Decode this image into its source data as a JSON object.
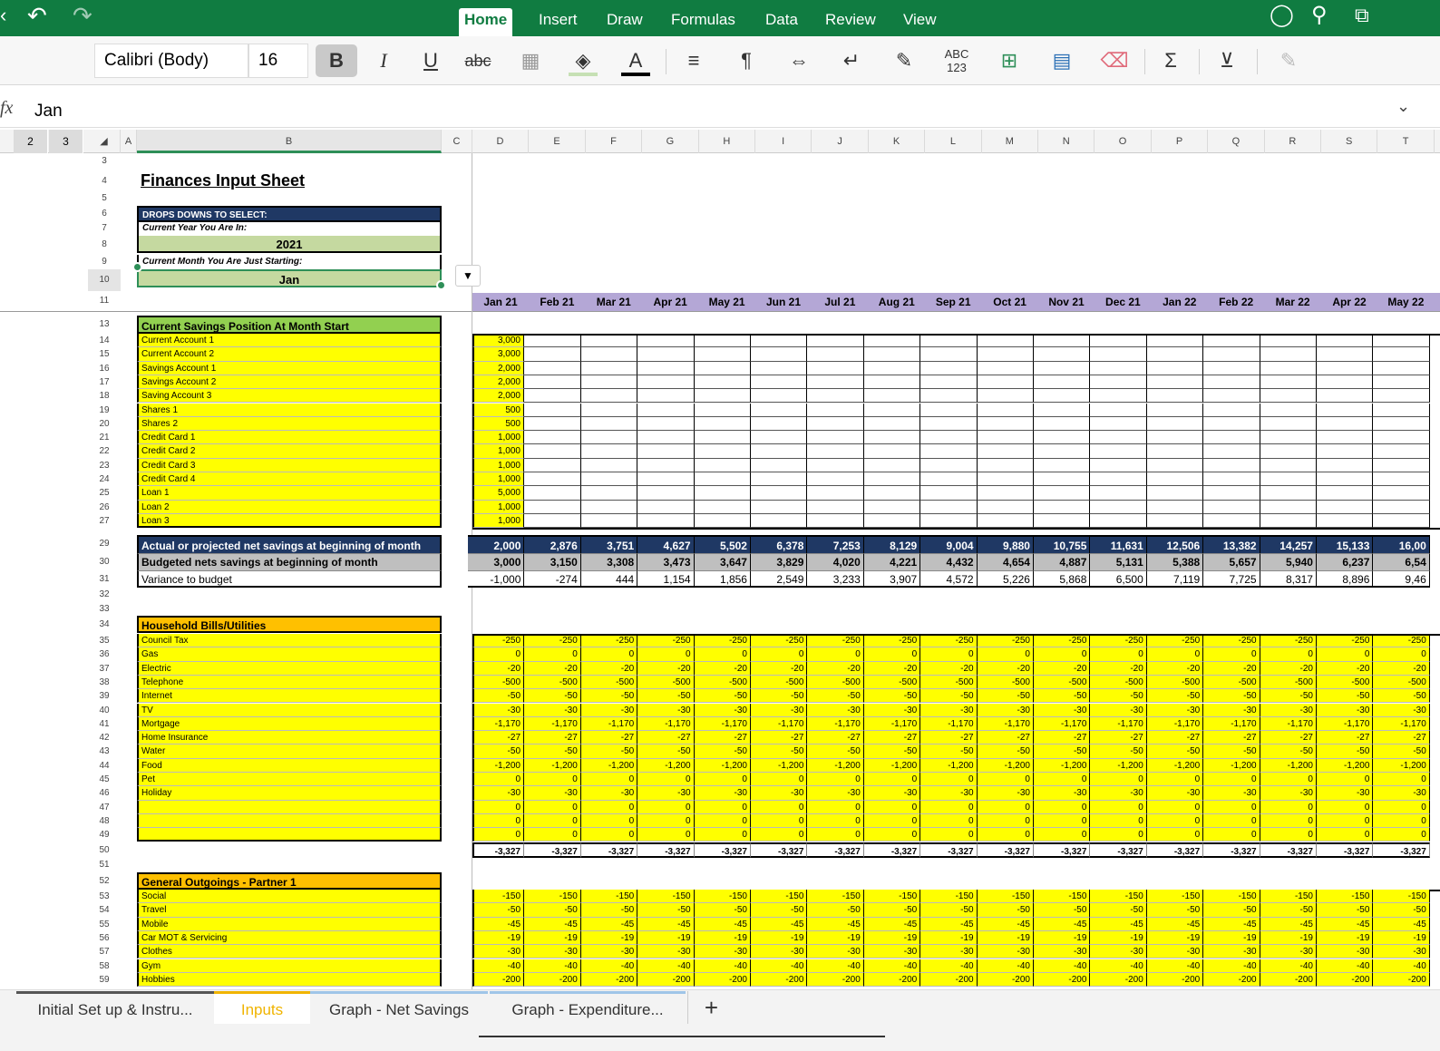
{
  "ribbon": {
    "tabs": [
      "Home",
      "Insert",
      "Draw",
      "Formulas",
      "Data",
      "Review",
      "View"
    ],
    "active": "Home"
  },
  "toolbar": {
    "font_name": "Calibri (Body)",
    "font_size": "16",
    "abc_label": "ABC",
    "num_label": "123"
  },
  "formula_bar": {
    "fx": "fx",
    "value": "Jan"
  },
  "outline_levels": [
    "2",
    "3"
  ],
  "columns": [
    "A",
    "B",
    "C",
    "D",
    "E",
    "F",
    "G",
    "H",
    "I",
    "J",
    "K",
    "L",
    "M",
    "N",
    "O",
    "P",
    "Q",
    "R",
    "S",
    "T"
  ],
  "sheet": {
    "title": "Finances Input Sheet",
    "dropdowns_header": "DROPS DOWNS TO SELECT:",
    "year_label": "Current Year You Are In:",
    "year_value": "2021",
    "month_label": "Current Month You Are Just Starting:",
    "month_value": "Jan",
    "months": [
      "Jan 21",
      "Feb 21",
      "Mar 21",
      "Apr 21",
      "May 21",
      "Jun 21",
      "Jul 21",
      "Aug 21",
      "Sep 21",
      "Oct 21",
      "Nov 21",
      "Dec 21",
      "Jan 22",
      "Feb 22",
      "Mar 22",
      "Apr 22",
      "May 22"
    ],
    "savings_header": "Current Savings Position At Month Start",
    "savings_items": [
      [
        "Current Account 1",
        "3,000"
      ],
      [
        "Current Account 2",
        "3,000"
      ],
      [
        "Savings Account 1",
        "2,000"
      ],
      [
        "Savings Account 2",
        "2,000"
      ],
      [
        "Saving Account 3",
        "2,000"
      ],
      [
        "Shares 1",
        "500"
      ],
      [
        "Shares 2",
        "500"
      ],
      [
        "Credit Card 1",
        "1,000"
      ],
      [
        "Credit Card 2",
        "1,000"
      ],
      [
        "Credit Card 3",
        "1,000"
      ],
      [
        "Credit Card 4",
        "1,000"
      ],
      [
        "Loan 1",
        "5,000"
      ],
      [
        "Loan 2",
        "1,000"
      ],
      [
        "Loan 3",
        "1,000"
      ]
    ],
    "summary": [
      {
        "label": "Actual or projected net savings at beginning of month",
        "values": [
          "2,000",
          "2,876",
          "3,751",
          "4,627",
          "5,502",
          "6,378",
          "7,253",
          "8,129",
          "9,004",
          "9,880",
          "10,755",
          "11,631",
          "12,506",
          "13,382",
          "14,257",
          "15,133",
          "16,00"
        ]
      },
      {
        "label": "Budgeted nets savings at beginning of month",
        "values": [
          "3,000",
          "3,150",
          "3,308",
          "3,473",
          "3,647",
          "3,829",
          "4,020",
          "4,221",
          "4,432",
          "4,654",
          "4,887",
          "5,131",
          "5,388",
          "5,657",
          "5,940",
          "6,237",
          "6,54"
        ]
      },
      {
        "label": "Variance to budget",
        "values": [
          "-1,000",
          "-274",
          "444",
          "1,154",
          "1,856",
          "2,549",
          "3,233",
          "3,907",
          "4,572",
          "5,226",
          "5,868",
          "6,500",
          "7,119",
          "7,725",
          "8,317",
          "8,896",
          "9,46"
        ]
      }
    ],
    "bills_header": "Household Bills/Utilities",
    "bills": [
      [
        "Council Tax",
        "-250"
      ],
      [
        "Gas",
        "0"
      ],
      [
        "Electric",
        "-20"
      ],
      [
        "Telephone",
        "-500"
      ],
      [
        "Internet",
        "-50"
      ],
      [
        "TV",
        "-30"
      ],
      [
        "Mortgage",
        "-1,170"
      ],
      [
        "Home Insurance",
        "-27"
      ],
      [
        "Water",
        "-50"
      ],
      [
        "Food",
        "-1,200"
      ],
      [
        "Pet",
        "0"
      ],
      [
        "Holiday",
        "-30"
      ],
      [
        "",
        "0"
      ],
      [
        "",
        "0"
      ],
      [
        "",
        "0"
      ]
    ],
    "bills_total": "-3,327",
    "outgoings_header": "General Outgoings - Partner 1",
    "outgoings": [
      [
        "Social",
        "-150"
      ],
      [
        "Travel",
        "-50"
      ],
      [
        "Mobile",
        "-45"
      ],
      [
        "Car MOT & Servicing",
        "-19"
      ],
      [
        "Clothes",
        "-30"
      ],
      [
        "Gym",
        "-40"
      ],
      [
        "Hobbies",
        "-200"
      ]
    ]
  },
  "sheet_tabs": [
    "Initial Set up & Instru...",
    "Inputs",
    "Graph - Net Savings",
    "Graph - Expenditure..."
  ],
  "active_sheet": "Inputs",
  "add_sheet": "+"
}
